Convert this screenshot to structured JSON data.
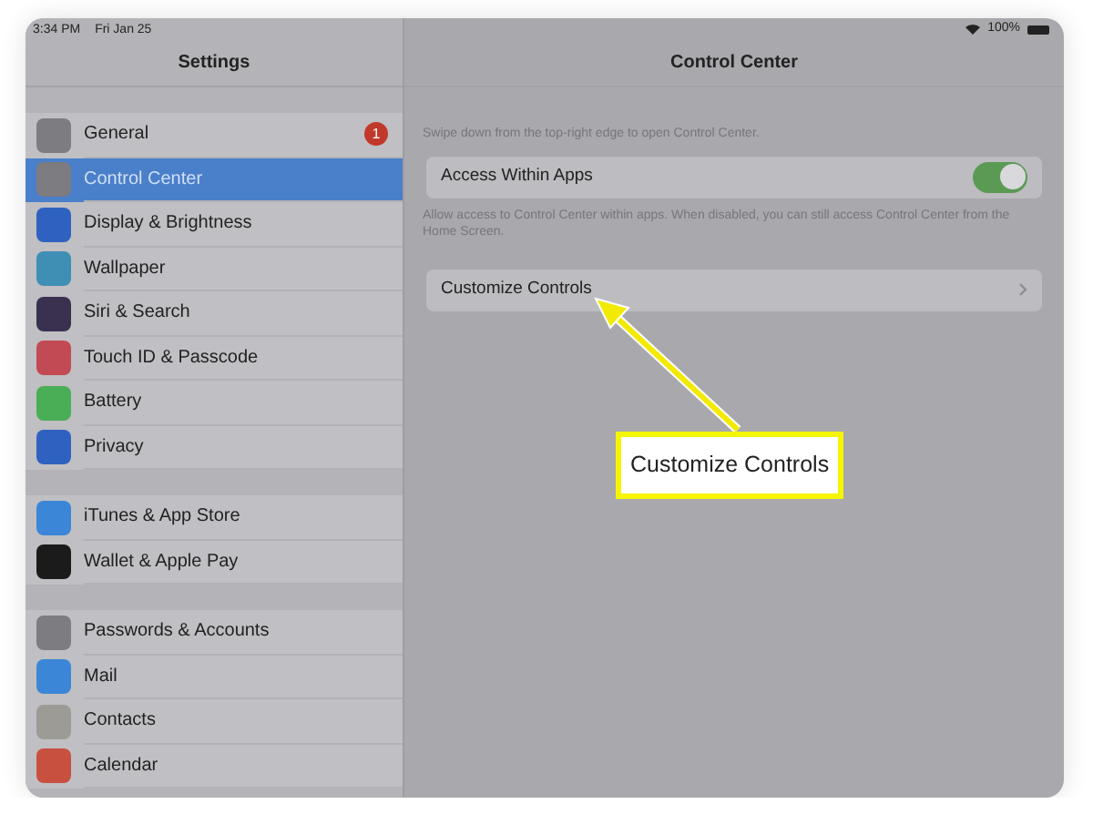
{
  "status_bar": {
    "time": "3:34 PM",
    "date": "Fri Jan 25",
    "battery": "100%"
  },
  "sidebar": {
    "title": "Settings",
    "groups": [
      [
        {
          "label": "General",
          "selected": false,
          "color": "#7d7c80",
          "badge": "1"
        },
        {
          "label": "Control Center",
          "selected": true,
          "color": "#7d7c80"
        },
        {
          "label": "Display & Brightness",
          "selected": false,
          "color": "#2f62c0"
        },
        {
          "label": "Wallpaper",
          "selected": false,
          "color": "#3f8fb5"
        },
        {
          "label": "Siri & Search",
          "selected": false,
          "color": "#3a3050"
        },
        {
          "label": "Touch ID & Passcode",
          "selected": false,
          "color": "#c24a55"
        },
        {
          "label": "Battery",
          "selected": false,
          "color": "#4aae57"
        },
        {
          "label": "Privacy",
          "selected": false,
          "color": "#2f62c0"
        }
      ],
      [
        {
          "label": "iTunes & App Store",
          "selected": false,
          "color": "#3b86d6"
        },
        {
          "label": "Wallet & Apple Pay",
          "selected": false,
          "color": "#1b1b1b"
        }
      ],
      [
        {
          "label": "Passwords & Accounts",
          "selected": false,
          "color": "#7d7c80"
        },
        {
          "label": "Mail",
          "selected": false,
          "color": "#3b86d6"
        },
        {
          "label": "Contacts",
          "selected": false,
          "color": "#9c9b96"
        },
        {
          "label": "Calendar",
          "selected": false,
          "color": "#c8503f"
        }
      ]
    ]
  },
  "detail": {
    "title": "Control Center",
    "description": "Swipe down from the top-right edge to open Control Center.",
    "toggle": {
      "label": "Access Within Apps",
      "on": true
    },
    "footnote": "Allow access to Control Center within apps. When disabled, you can still access Control Center from the Home Screen.",
    "link": {
      "label": "Customize Controls"
    }
  },
  "callout": {
    "text": "Customize Controls"
  }
}
